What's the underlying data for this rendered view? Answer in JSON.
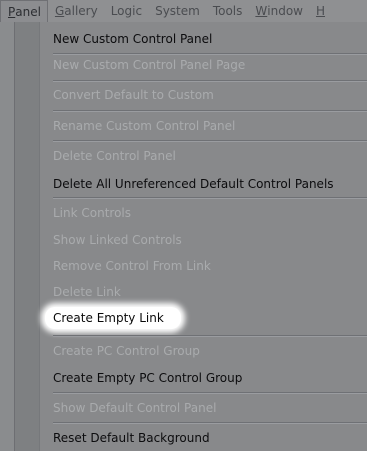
{
  "menubar": {
    "items": [
      {
        "prefix": "",
        "accel": "P",
        "rest": "anel"
      },
      {
        "prefix": "",
        "accel": "G",
        "rest": "allery"
      },
      {
        "prefix": "",
        "accel": "",
        "rest": "Logic"
      },
      {
        "prefix": "",
        "accel": "",
        "rest": "System"
      },
      {
        "prefix": "",
        "accel": "",
        "rest": "Tools"
      },
      {
        "prefix": "",
        "accel": "W",
        "rest": "indow"
      },
      {
        "prefix": "",
        "accel": "H",
        "rest": ""
      }
    ]
  },
  "menu": {
    "items": [
      {
        "label": "New Custom Control Panel",
        "enabled": true
      },
      {
        "label": "New Custom Control Panel Page",
        "enabled": false
      },
      {
        "label": "Convert Default to Custom",
        "enabled": false
      },
      {
        "label": "Rename Custom Control Panel",
        "enabled": false
      },
      {
        "label": "Delete Control Panel",
        "enabled": false
      },
      {
        "label": "Delete All Unreferenced Default Control Panels",
        "enabled": true
      },
      {
        "label": "Link Controls",
        "enabled": false
      },
      {
        "label": "Show Linked Controls",
        "enabled": false
      },
      {
        "label": "Remove Control From Link",
        "enabled": false
      },
      {
        "label": "Delete Link",
        "enabled": false
      },
      {
        "label": "Create Empty Link",
        "enabled": true,
        "highlighted": true
      },
      {
        "label": "Create PC Control Group",
        "enabled": false
      },
      {
        "label": "Create Empty PC Control Group",
        "enabled": true
      },
      {
        "label": "Show Default Control Panel",
        "enabled": false
      },
      {
        "label": "Reset Default Background",
        "enabled": true
      }
    ]
  }
}
